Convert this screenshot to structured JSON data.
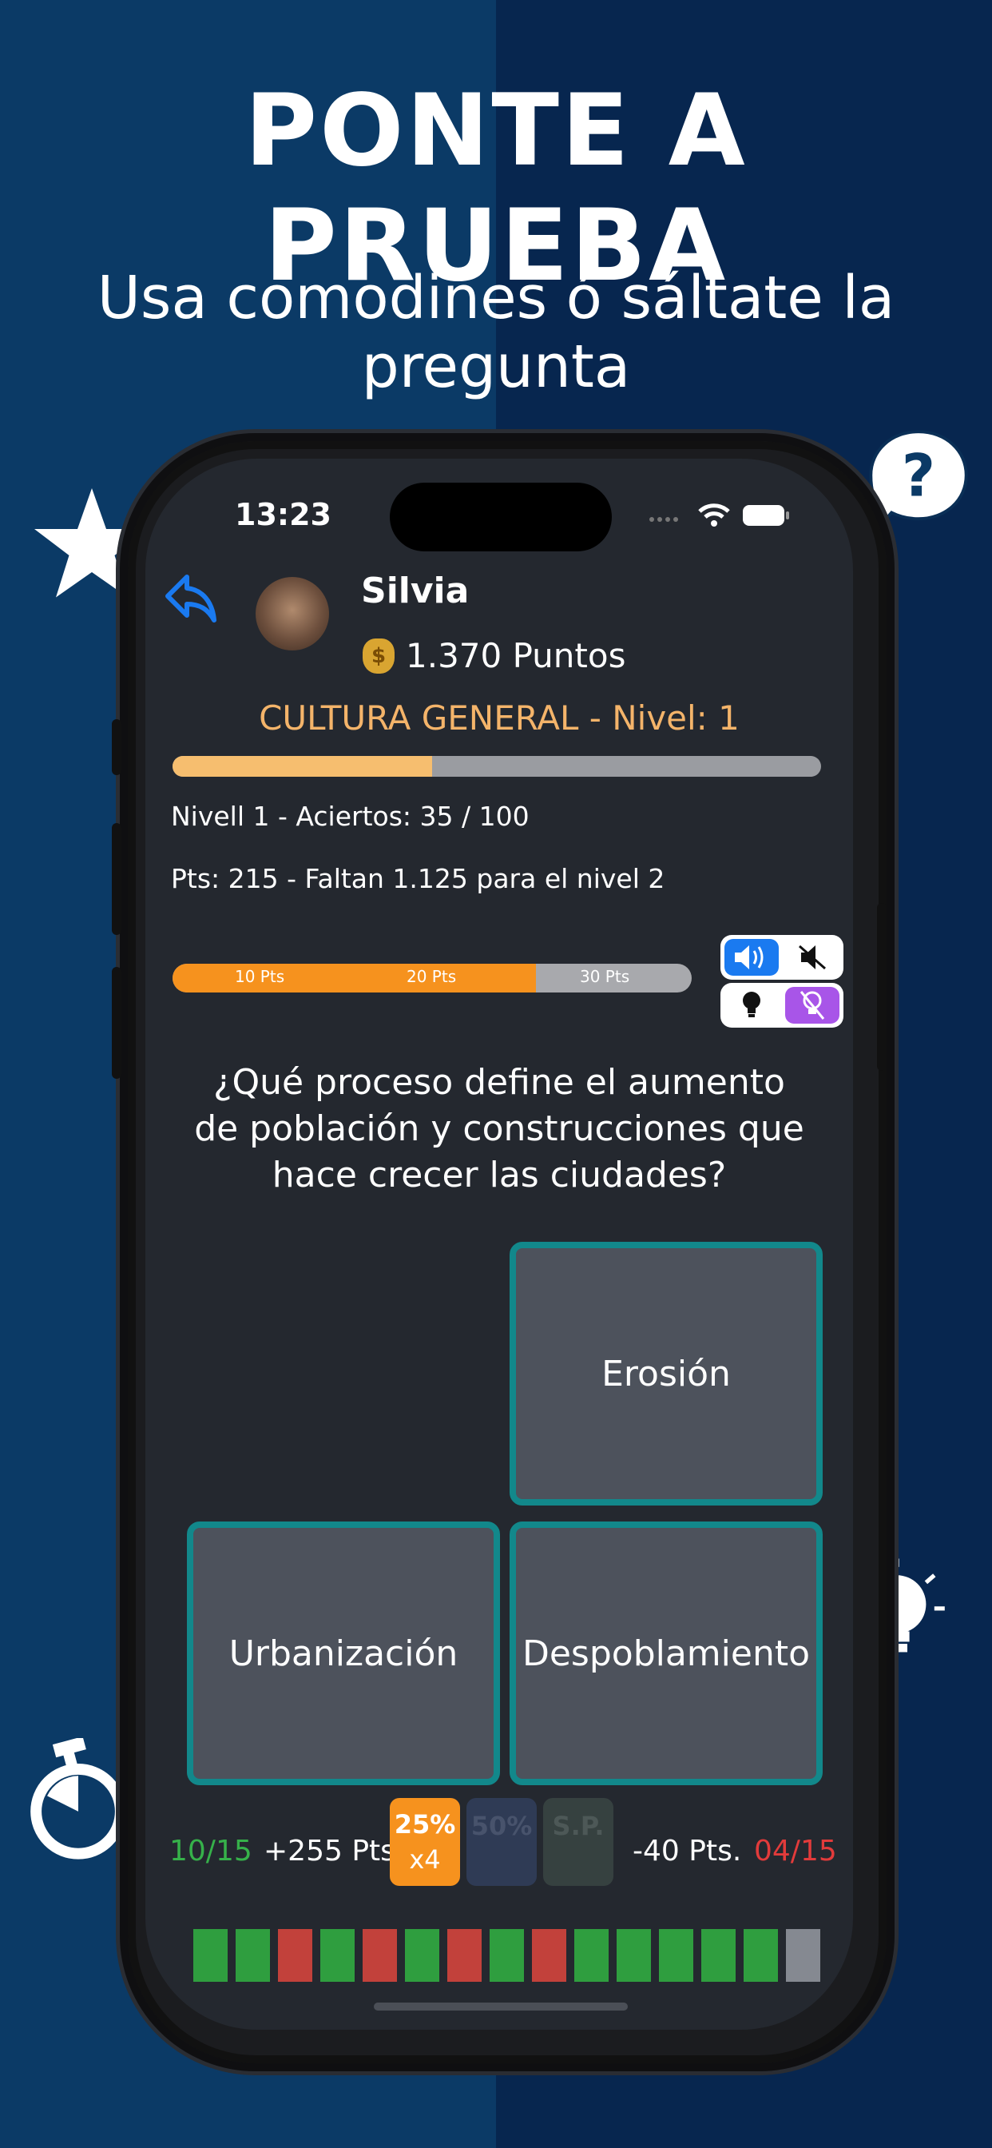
{
  "promo": {
    "headline": "PONTE A PRUEBA",
    "subheadline": "Usa comodines ó sáltate la pregunta"
  },
  "status_bar": {
    "time": "13:23"
  },
  "player": {
    "name": "Silvia",
    "points_text": "1.370 Puntos"
  },
  "category": {
    "title": "CULTURA GENERAL - Nivel: 1",
    "level_progress": 0.4
  },
  "stats": {
    "level_line": "Nivell 1 - Aciertos: 35 / 100",
    "points_line": "Pts: 215 - Faltan 1.125 para el nivel 2"
  },
  "points_bar": {
    "ticks": [
      "10 Pts",
      "20 Pts",
      "30 Pts"
    ],
    "progress": 0.7
  },
  "toggles": {
    "sound_on_icon": "speaker-on-icon",
    "sound_off_icon": "speaker-muted-icon",
    "hint_icon": "lightbulb-icon",
    "hint_off_icon": "lightbulb-off-icon"
  },
  "question": {
    "text": "¿Qué proceso define el aumento de población y construcciones que hace crecer las ciudades?"
  },
  "answers": [
    {
      "label": "Erosión"
    },
    {
      "label": "Urbanización"
    },
    {
      "label": "Despoblamiento"
    }
  ],
  "bottom": {
    "correct_count": "10/15",
    "gain": "+255 Pts.",
    "loss": "-40 Pts.",
    "wrong_count": "04/15",
    "jokers": [
      {
        "label": "25%",
        "count": "x4",
        "active": true
      },
      {
        "label": "50%",
        "active": false
      },
      {
        "label": "S.P.",
        "active": false
      }
    ]
  },
  "history": [
    "correct",
    "correct",
    "wrong",
    "correct",
    "wrong",
    "correct",
    "wrong",
    "correct",
    "wrong",
    "correct",
    "correct",
    "correct",
    "correct",
    "correct",
    "pending"
  ],
  "colors": {
    "correct": "#2f9e3f",
    "wrong": "#c2413b",
    "pending": "#858991",
    "accent": "#f6921e",
    "answer_border": "#12888b"
  }
}
